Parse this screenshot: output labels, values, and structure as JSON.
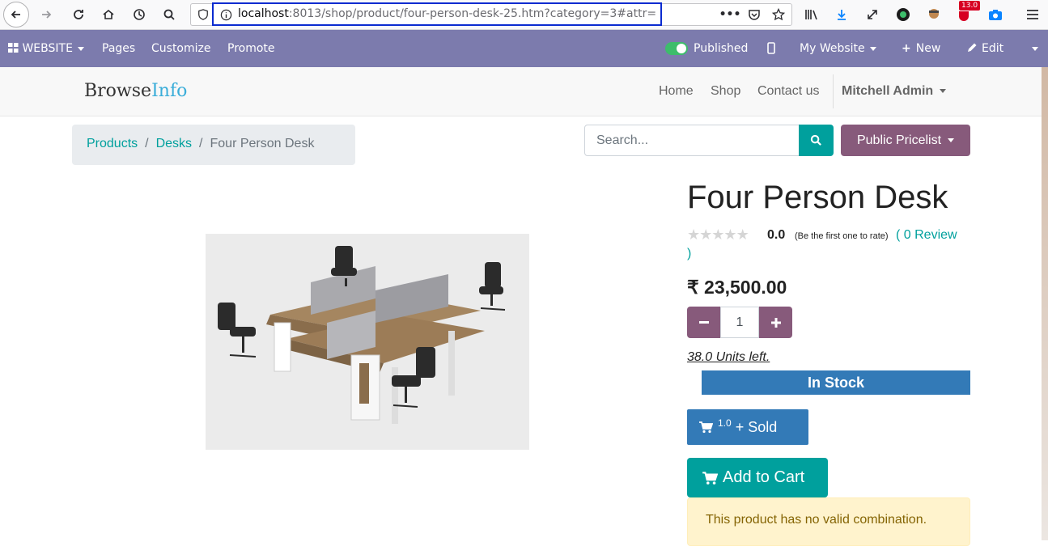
{
  "browser": {
    "url_host": "localhost",
    "url_rest": ":8013/shop/product/four-person-desk-25.htm?category=3#attr=",
    "extension_badge": "13.0"
  },
  "odoo_bar": {
    "website_label": "WEBSITE",
    "pages": "Pages",
    "customize": "Customize",
    "promote": "Promote",
    "published": "Published",
    "my_website": "My Website",
    "new": "New",
    "edit": "Edit"
  },
  "header": {
    "logo_main": "Browse",
    "logo_accent": "Info",
    "menu": {
      "home": "Home",
      "shop": "Shop",
      "contact": "Contact us"
    },
    "user": "Mitchell Admin"
  },
  "breadcrumb": {
    "products": "Products",
    "desks": "Desks",
    "current": "Four Person Desk",
    "sep": "/"
  },
  "search": {
    "placeholder": "Search..."
  },
  "pricelist": {
    "label": "Public Pricelist"
  },
  "product": {
    "title": "Four Person Desk",
    "rating_value": "0.0",
    "rating_note": "(Be the first one to rate)",
    "review_link": "( 0 Review",
    "review_close": ")",
    "price": "₹ 23,500.00",
    "quantity": "1",
    "units_left": "38.0 Units left.",
    "stock_status": "In Stock",
    "sold_count": "1.0",
    "sold_label": "+ Sold",
    "add_to_cart": "Add to Cart",
    "alert": "This product has no valid combination."
  },
  "colors": {
    "odoo_bar": "#7c7bad",
    "primary_teal": "#00a09d",
    "odoo_purple": "#875a7b",
    "stock_blue": "#337ab7",
    "url_highlight": "#0b2bd0"
  }
}
